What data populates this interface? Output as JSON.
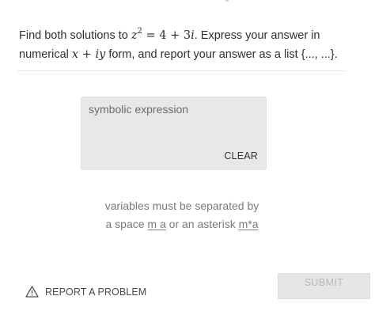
{
  "question": {
    "text_before_eq": "Find both solutions to ",
    "eq_var": "z",
    "eq_exp": "2",
    "eq_rhs": " = 4 + 3",
    "eq_i": "i",
    "text_after_eq": ". Express your answer in numerical ",
    "form_x": "x",
    "form_plus": " + ",
    "form_iy": "iy",
    "text_after_form": " form, and report your answer as a list {..., ...}."
  },
  "answer": {
    "placeholder": "symbolic expression",
    "clear_label": "CLEAR"
  },
  "hint": {
    "line1": "variables must be separated by",
    "line2_before": "a space ",
    "line2_code1": "m a",
    "line2_middle": " or an asterisk ",
    "line2_code2": "m*a"
  },
  "footer": {
    "report_label": "REPORT A PROBLEM",
    "report_icon": "warning-triangle-icon",
    "submit_label": "SUBMIT",
    "submit_enabled": false
  }
}
